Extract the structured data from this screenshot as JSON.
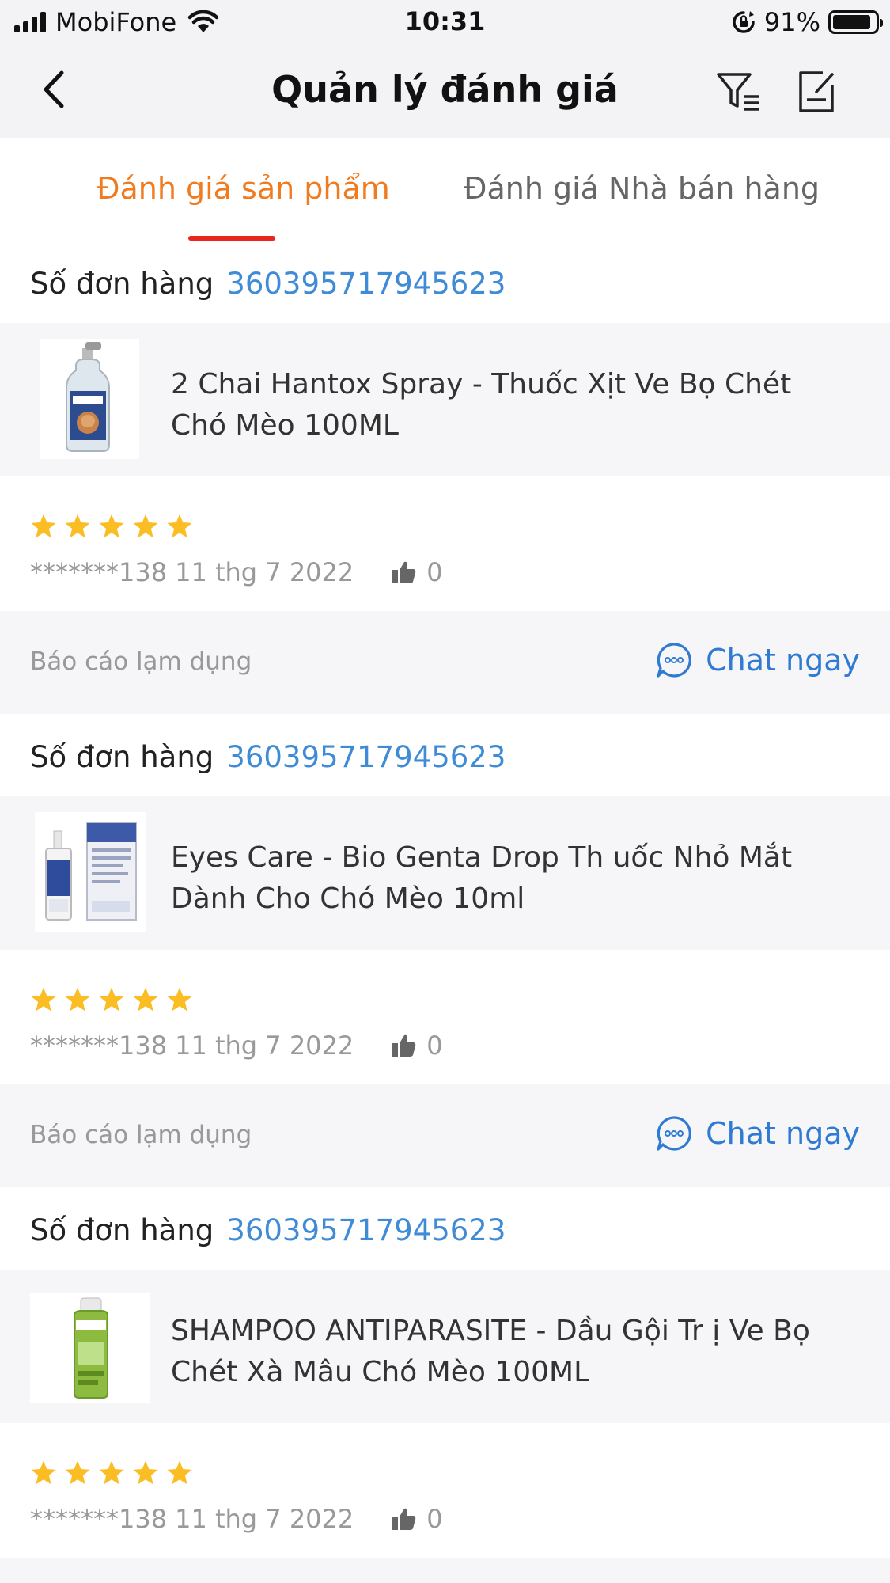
{
  "status_bar": {
    "carrier": "MobiFone",
    "time": "10:31",
    "battery": "91%",
    "battery_level": 0.91
  },
  "header": {
    "title": "Quản lý đánh giá"
  },
  "tabs": [
    {
      "label": "Đánh giá sản phẩm",
      "active": true
    },
    {
      "label": "Đánh giá Nhà bán hàng",
      "active": false
    }
  ],
  "labels": {
    "order_label": "Số đơn hàng",
    "report": "Báo cáo lạm dụng",
    "chat": "Chat ngay"
  },
  "colors": {
    "accent_orange": "#f07c22",
    "tab_indicator": "#e8261d",
    "link_blue": "#3f8bd6",
    "star": "#fbbd24"
  },
  "reviews": [
    {
      "order_number": "360395717945623",
      "product_name": "2 Chai Hantox Spray - Thuốc Xịt Ve Bọ Chét Chó Mèo 100ML",
      "rating": 5,
      "reviewer": "*******138",
      "date": "11 thg 7 2022",
      "likes": "0"
    },
    {
      "order_number": "360395717945623",
      "product_name": "Eyes Care - Bio Genta Drop Th uốc Nhỏ Mắt Dành Cho Chó Mèo 10ml",
      "rating": 5,
      "reviewer": "*******138",
      "date": "11 thg 7 2022",
      "likes": "0"
    },
    {
      "order_number": "360395717945623",
      "product_name": "SHAMPOO ANTIPARASITE - Dầu Gội Tr ị Ve Bọ Chét Xà Mâu Chó Mèo 100ML",
      "rating": 5,
      "reviewer": "*******138",
      "date": "11 thg 7 2022",
      "likes": "0"
    }
  ]
}
